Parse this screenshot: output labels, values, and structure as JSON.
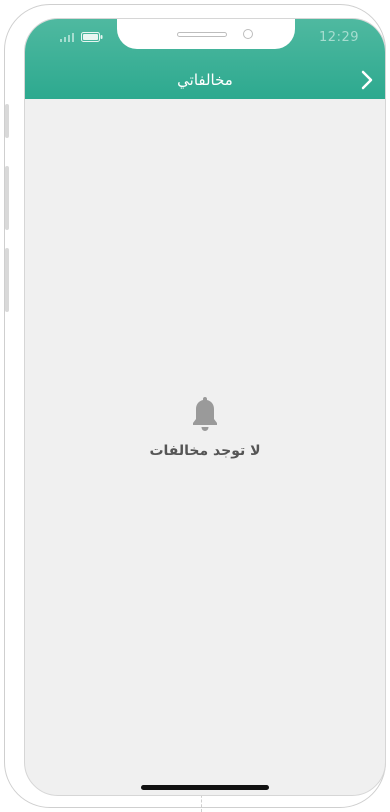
{
  "status_bar": {
    "time": "12:29",
    "signal_icon": "signal-bars-icon",
    "battery_icon": "battery-icon"
  },
  "header": {
    "title": "مخالفاتي",
    "back_icon": "chevron-right-icon",
    "color": "#2da98f"
  },
  "empty_state": {
    "icon": "bell-icon",
    "message": "لا توجد مخالفات"
  }
}
